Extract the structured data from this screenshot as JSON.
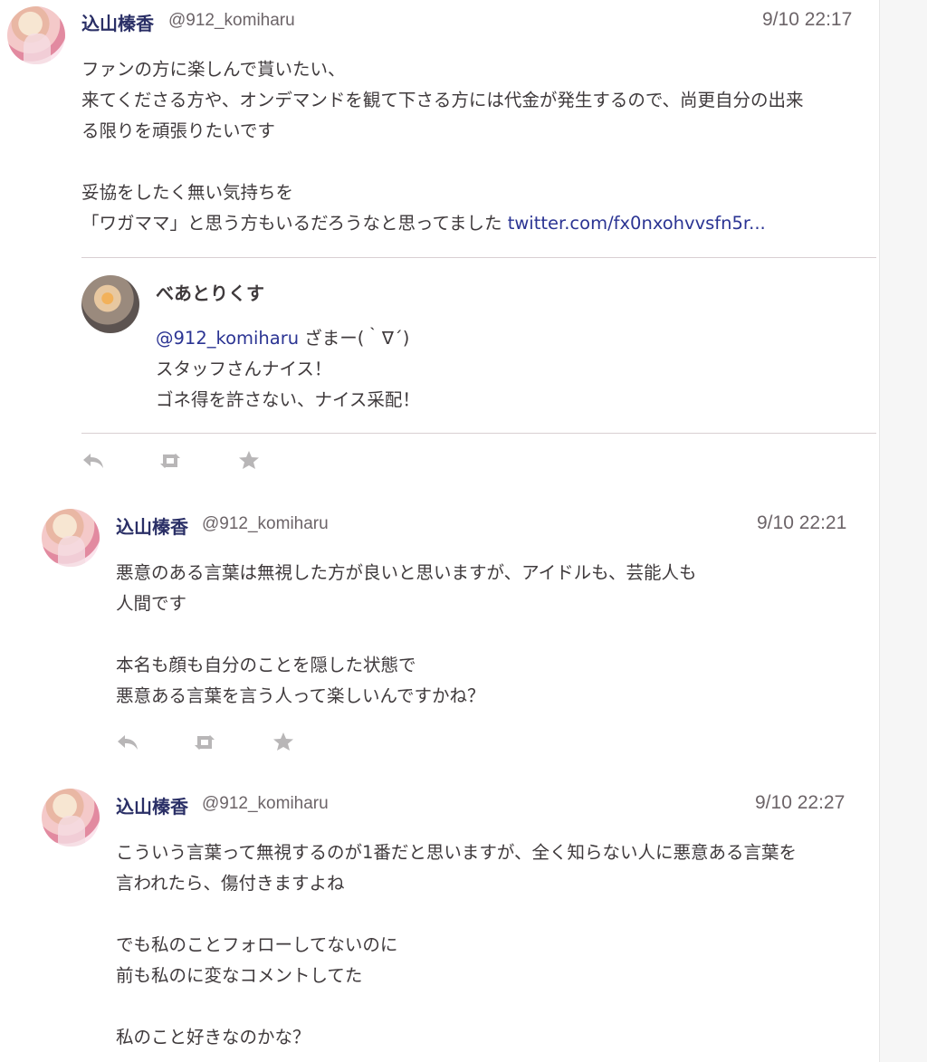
{
  "tweets": [
    {
      "name": "込山榛香",
      "handle": "@912_komiharu",
      "time": "9/10 22:17",
      "lines": [
        "ファンの方に楽しんで貰いたい、",
        "来てくださる方や、オンデマンドを観て下さる方には代金が発生するので、尚更自分の出来",
        "る限りを頑張りたいです",
        "",
        "妥協をしたく無い気持ちを",
        "「ワガママ」と思う方もいるだろうなと思ってました "
      ],
      "link": "twitter.com/fx0nxohvvsfn5r..."
    },
    {
      "name": "込山榛香",
      "handle": "@912_komiharu",
      "time": "9/10 22:21",
      "lines": [
        "悪意のある言葉は無視した方が良いと思いますが、アイドルも、芸能人も",
        "人間です",
        "",
        "本名も顔も自分のことを隠した状態で",
        "悪意ある言葉を言う人って楽しいんですかね？"
      ]
    },
    {
      "name": "込山榛香",
      "handle": "@912_komiharu",
      "time": "9/10 22:27",
      "lines": [
        "こういう言葉って無視するのが1番だと思いますが、全く知らない人に悪意ある言葉を",
        "言われたら、傷付きますよね",
        "",
        "でも私のことフォローしてないのに",
        "前も私のに変なコメントしてた",
        "",
        "私のこと好きなのかな？"
      ]
    }
  ],
  "quoted": {
    "name": "べあとりくす",
    "mention": "@912_komiharu",
    "line1_rest": " ざまー(｀∇´)",
    "line2": "スタッフさんナイス！",
    "line3": "ゴネ得を許さない、ナイス采配！"
  },
  "icons": {
    "reply": "reply-icon",
    "retweet": "retweet-icon",
    "favorite": "star-icon"
  }
}
